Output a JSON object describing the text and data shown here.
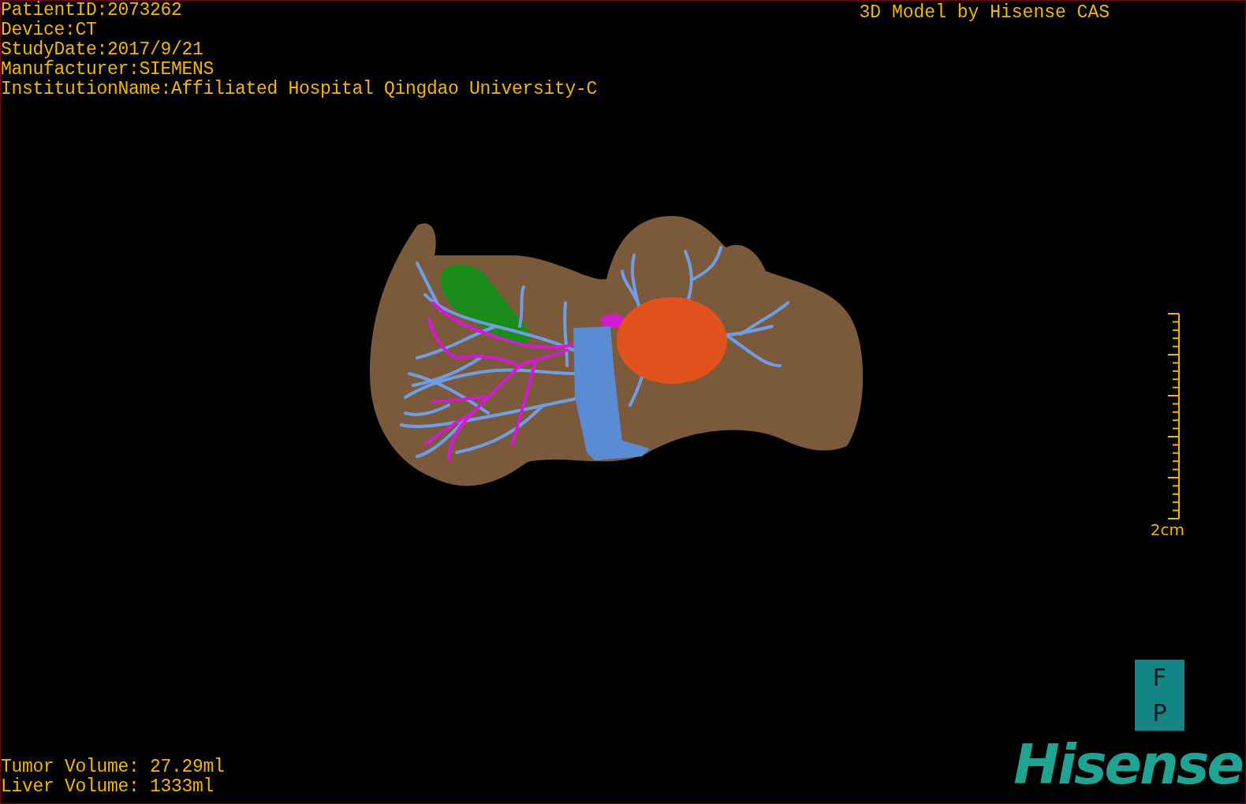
{
  "patient_info": [
    "PatientID:2073262",
    "Device:CT",
    "StudyDate:2017/9/21",
    "Manufacturer:SIEMENS",
    "InstitutionName:Affiliated Hospital Qingdao University-C"
  ],
  "title": "3D Model by Hisense CAS",
  "scale_bar": {
    "label": "2cm"
  },
  "orientation": [
    "F",
    "P"
  ],
  "volumes": [
    "Tumor Volume: 27.29ml",
    "Liver Volume: 1333ml"
  ],
  "logo": "Hisense"
}
